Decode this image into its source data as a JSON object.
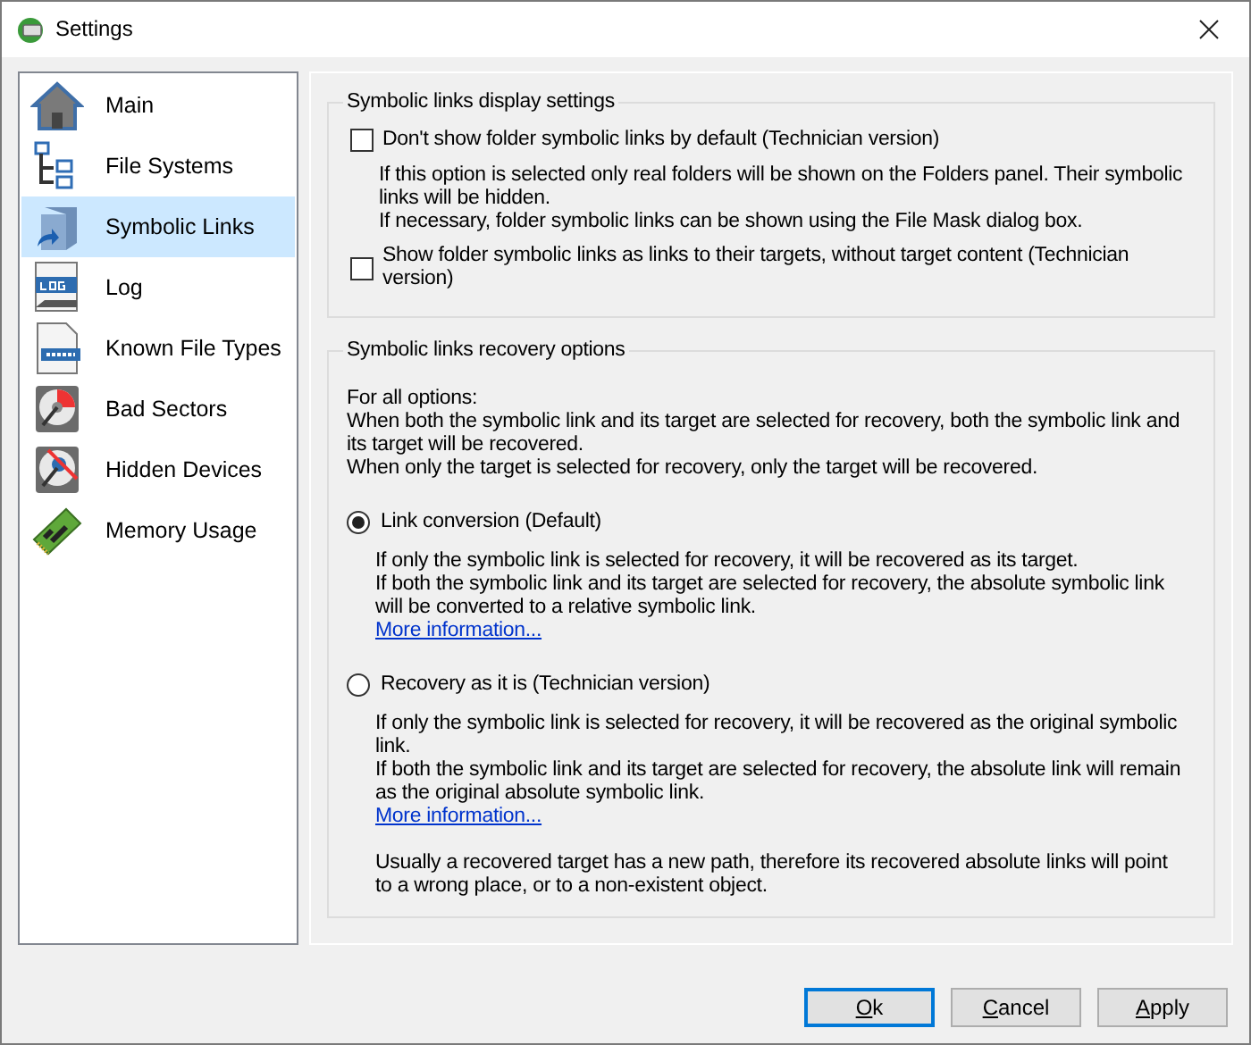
{
  "window": {
    "title": "Settings"
  },
  "sidebar": {
    "items": [
      {
        "label": "Main",
        "kind": "house",
        "selected": false
      },
      {
        "label": "File Systems",
        "kind": "tree",
        "selected": false
      },
      {
        "label": "Symbolic Links",
        "kind": "folder-link",
        "selected": true
      },
      {
        "label": "Log",
        "kind": "log",
        "selected": false
      },
      {
        "label": "Known File Types",
        "kind": "file",
        "selected": false
      },
      {
        "label": "Bad Sectors",
        "kind": "disk-bad",
        "selected": false
      },
      {
        "label": "Hidden Devices",
        "kind": "disk-hidden",
        "selected": false
      },
      {
        "label": "Memory Usage",
        "kind": "memory",
        "selected": false
      }
    ]
  },
  "display_group": {
    "title": "Symbolic links display settings",
    "options": [
      {
        "kind": "checkbox",
        "label": "Don't show folder symbolic links by default (Technician version)",
        "checked": false,
        "description": [
          "If this option is selected only real folders will be shown on the Folders panel. Their symbolic links will be hidden.",
          "If necessary, folder symbolic links can be shown using the File Mask dialog box."
        ]
      },
      {
        "kind": "checkbox",
        "label": "Show folder symbolic links as links to their targets, without target content (Technician version)",
        "checked": false
      }
    ]
  },
  "recovery_group": {
    "title": "Symbolic links recovery options",
    "intro": [
      "For all options:",
      "When both the symbolic link and its target are selected for recovery, both the symbolic link and its target will be recovered.",
      "When only the target is selected for recovery, only the target will be recovered."
    ],
    "options": [
      {
        "kind": "radio",
        "label": "Link conversion (Default)",
        "selected": true,
        "description": [
          "If only the symbolic link is selected for recovery, it will be recovered as its target.",
          "If both the symbolic link and its target are selected for recovery, the absolute symbolic link will be converted to a relative symbolic link."
        ],
        "link": "More information..."
      },
      {
        "kind": "radio",
        "label": "Recovery as it is (Technician version)",
        "selected": false,
        "description": [
          "If only the symbolic link is selected for recovery, it will be recovered as the original symbolic link.",
          "If both the symbolic link and its target are selected for recovery, the absolute link will remain as the original absolute symbolic link."
        ],
        "link": "More information..."
      }
    ],
    "note": "Usually a recovered target has a new path, therefore its recovered absolute links will point to a wrong place, or to a non-existent object."
  },
  "buttons": [
    {
      "label": "Ok",
      "default": true
    },
    {
      "label": "Cancel",
      "default": false
    },
    {
      "label": "Apply",
      "default": false
    }
  ]
}
